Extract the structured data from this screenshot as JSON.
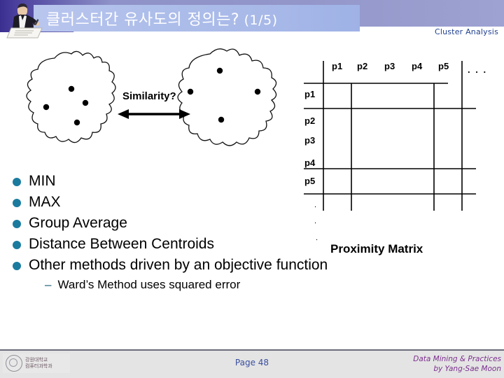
{
  "header": {
    "title_main": "클러스터간 유사도의 정의는?",
    "title_suffix": " (1/5)",
    "section_label": "Cluster Analysis",
    "presenter_icon": "presenter-writing-icon"
  },
  "diagram": {
    "similarity_label": "Similarity?",
    "left_cluster_name": "cluster-blob-left",
    "right_cluster_name": "cluster-blob-right",
    "left_cluster_points": 4,
    "right_cluster_points": 4,
    "arrow_name": "double-headed-arrow-icon"
  },
  "bullets": [
    {
      "label": "MIN"
    },
    {
      "label": "MAX"
    },
    {
      "label": "Group Average"
    },
    {
      "label": "Distance Between Centroids"
    },
    {
      "label": "Other methods driven by an objective function"
    }
  ],
  "sub_bullets": [
    {
      "dash": "–",
      "label": "Ward’s Method uses squared error"
    }
  ],
  "matrix": {
    "caption": "Proximity Matrix",
    "col_headers": [
      "p1",
      "p2",
      "p3",
      "p4",
      "p5"
    ],
    "col_ellipsis": ". . .",
    "row_headers": [
      "p1",
      "p2",
      "p3",
      "p4",
      "p5"
    ],
    "row_ellipsis": [
      ".",
      ".",
      "."
    ],
    "cells": [
      [
        "",
        "",
        "",
        "",
        ""
      ],
      [
        "",
        "",
        "",
        "",
        ""
      ],
      [
        "",
        "",
        "",
        "",
        ""
      ],
      [
        "",
        "",
        "",
        "",
        ""
      ],
      [
        "",
        "",
        "",
        "",
        ""
      ]
    ]
  },
  "footer": {
    "page_label": "Page 48",
    "credit_line1": "Data Mining & Practices",
    "credit_line2": "by Yang-Sae Moon",
    "logo_line1": "강원대학교",
    "logo_line2": "컴퓨터과학과",
    "logo_icon": "university-seal-icon"
  },
  "colors": {
    "band": "#9296c9",
    "title_box": "#aebeea",
    "bullet": "#1b7b9e",
    "section_label": "#1f3f8f",
    "page_label": "#3a4fa0",
    "credit": "#7b2f8e"
  }
}
